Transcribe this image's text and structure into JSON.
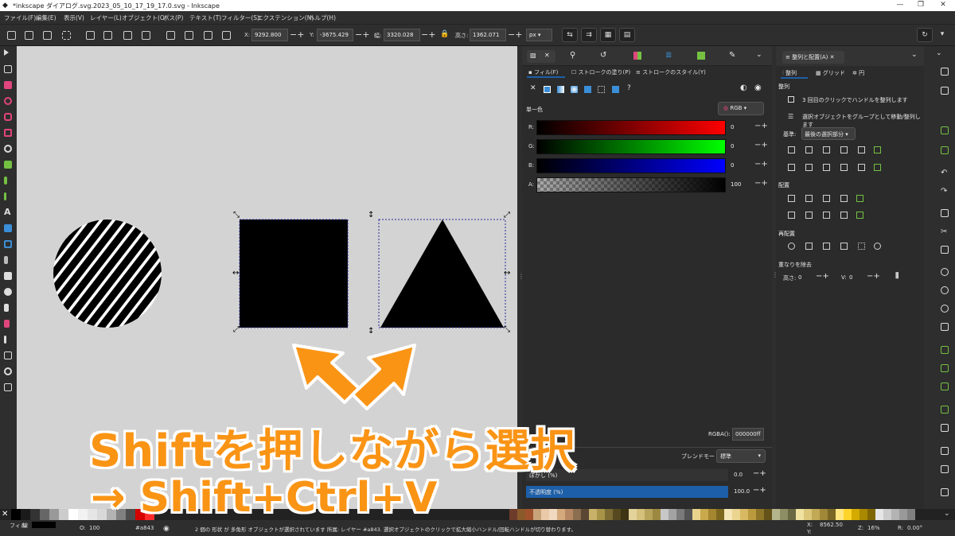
{
  "window": {
    "title": "*inkscape ダイアログ.svg.2023_05_10_17_19_17.0.svg - Inkscape",
    "minimize": "—",
    "restore": "❐",
    "close": "✕"
  },
  "menu": [
    "ファイル(F)",
    "編集(E)",
    "表示(V)",
    "レイヤー(L)",
    "オブジェクト(O)",
    "パス(P)",
    "テキスト(T)",
    "フィルター(S)",
    "エクステンション(N)",
    "ヘルプ(H)"
  ],
  "toolbar": {
    "x_label": "X:",
    "x_value": "9292.800",
    "y_label": "Y:",
    "y_value": "-3675.429",
    "w_label": "幅:",
    "w_value": "3320.028",
    "h_label": "高さ:",
    "h_value": "1362.071",
    "unit": "px"
  },
  "fill_panel": {
    "tab_fill": "フィル(F)",
    "tab_stroke_paint": "ストロークの塗り(P)",
    "tab_stroke_style": "ストロークのスタイル(Y)",
    "help": "?",
    "mode_label": "単一色",
    "color_mode": "RGB",
    "r_label": "R:",
    "r_value": "0",
    "g_label": "G:",
    "g_value": "0",
    "b_label": "B:",
    "b_value": "0",
    "a_label": "A:",
    "a_value": "100",
    "rgba_label": "RGBA():",
    "rgba_value": "000000ff",
    "blend_label": "ブレンドモード:",
    "blend_value": "標準",
    "blur_label": "ぼかし (%)",
    "blur_value": "0.0",
    "opacity_label": "不透明度 (%)",
    "opacity_value": "100.0"
  },
  "align_panel": {
    "title": "整列と配置(A)",
    "tab_align": "整列",
    "tab_grid": "グリッド",
    "tab_circle": "円",
    "section_align": "整列",
    "opt1": "3 回目のクリックでハンドルを整列します",
    "opt2": "選択オブジェクトをグループとして移動/整列します",
    "relative_label": "基準:",
    "relative_value": "最後の選択部分",
    "section_distribute": "配置",
    "section_rearrange": "再配置",
    "section_overlap": "重なりを除去",
    "h_label": "高さ:",
    "h_value": "0",
    "v_label": "V:",
    "v_value": "0"
  },
  "status": {
    "fill_label": "フィル",
    "stroke_label": "線",
    "opacity_label": "O:",
    "opacity_value": "100",
    "layer": "#a843",
    "message": "2 個の 形状 が 多角形 オブジェクトが選択されています 所属: レイヤー #a843. 選択オブジェクトのクリックで拡大縮小ハンドル/回転ハンドルが切り替わります。",
    "x_label": "X:",
    "x_value": "8562.50",
    "y_label": "Y:",
    "y_value": "",
    "zoom_label": "Z:",
    "zoom_value": "16%",
    "rot_label": "R:",
    "rot_value": "0.00°"
  },
  "overlay": {
    "line1": "Shiftを押しながら選択",
    "line2": "→ Shift+Ctrl+V"
  },
  "colors": {
    "accent": "#fa9415",
    "selected_tab": "#1d5fa8",
    "canvas": "#d3d3d3"
  }
}
